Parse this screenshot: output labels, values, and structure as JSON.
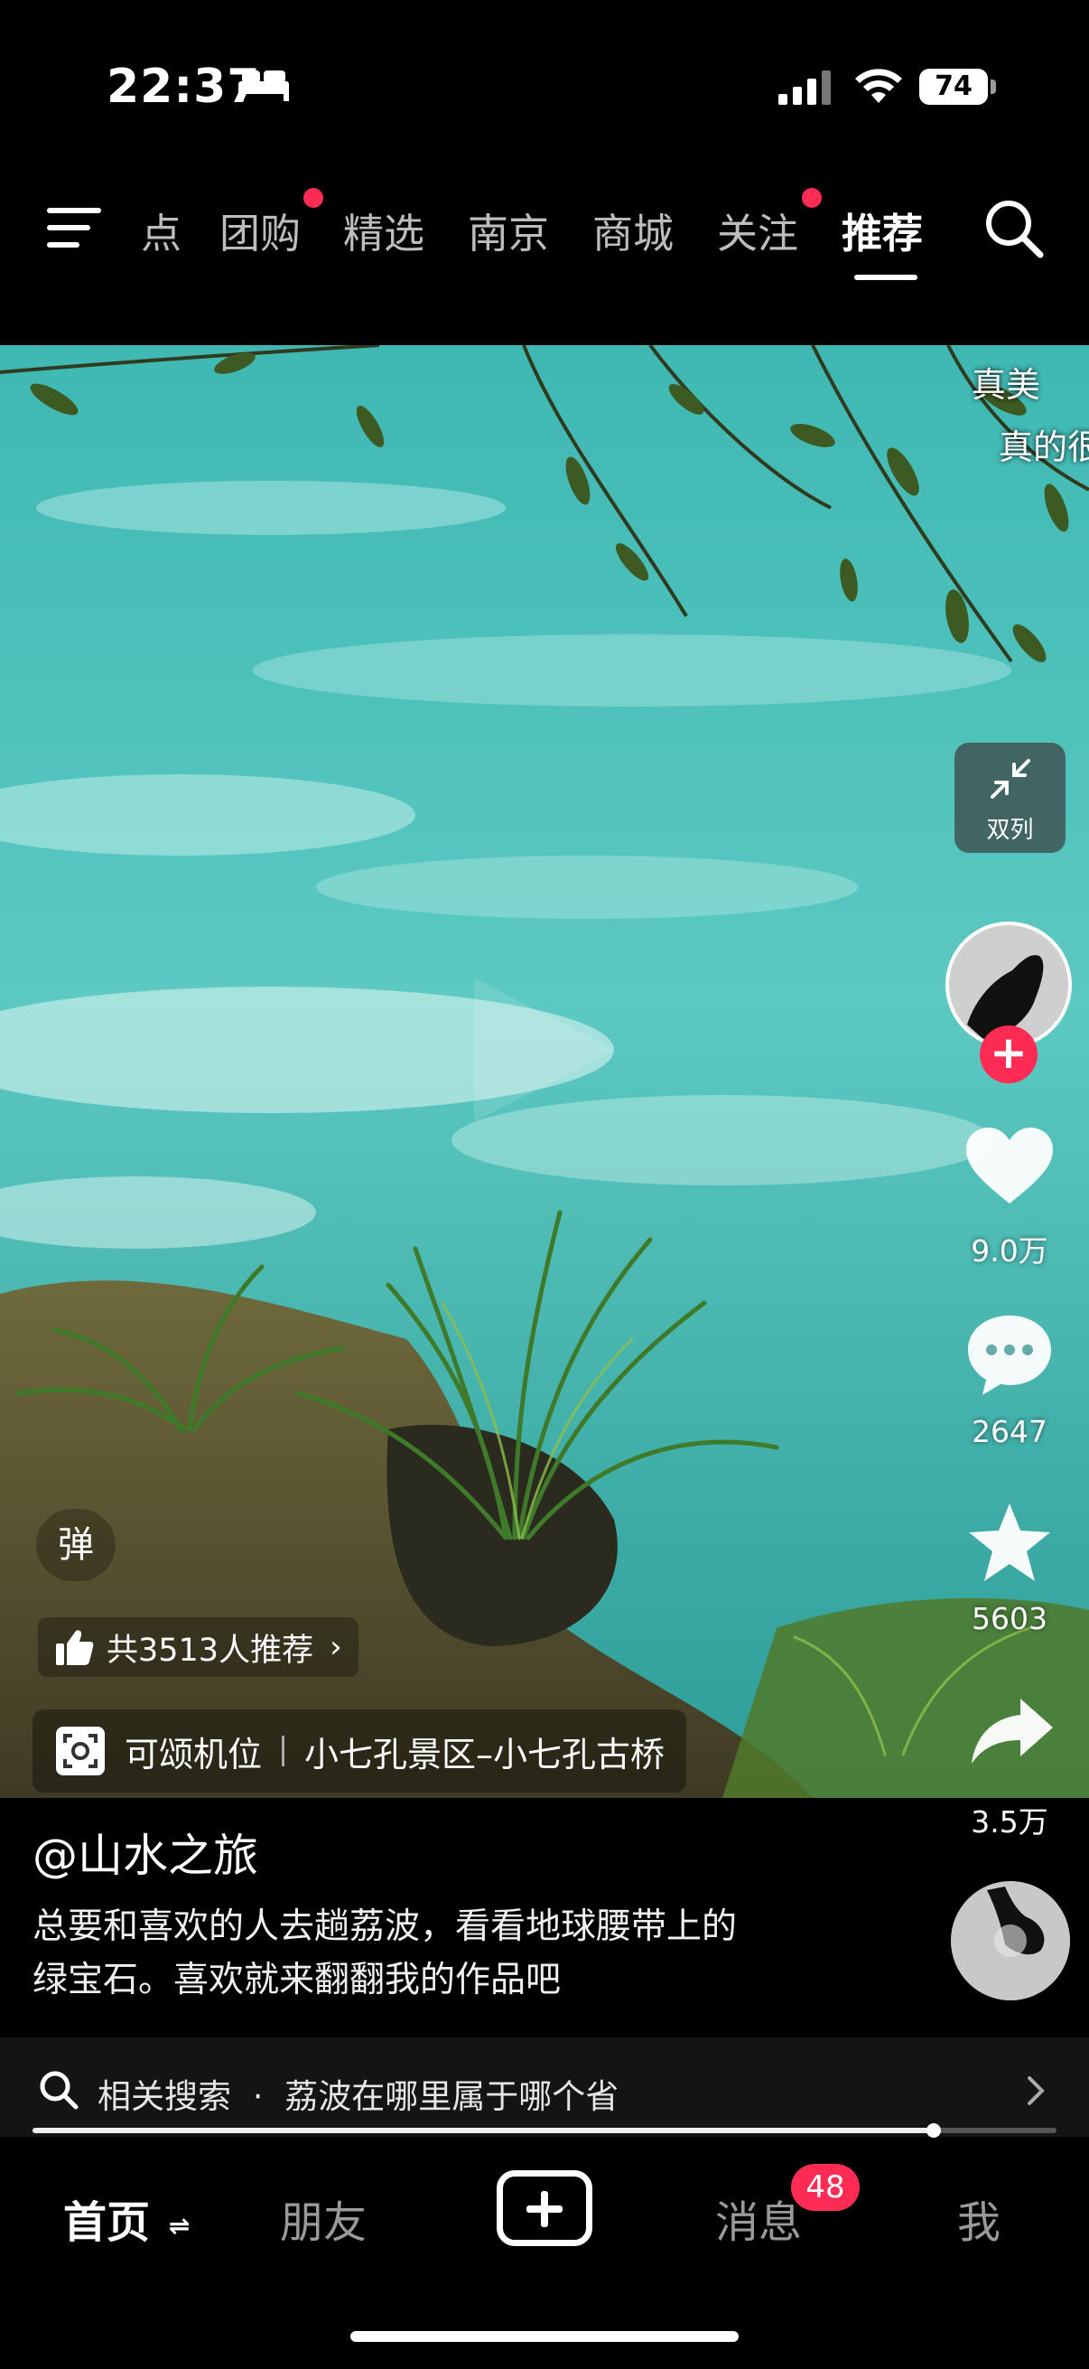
{
  "status_bar": {
    "time": "22:37",
    "battery": "74",
    "icons": [
      "bed-icon",
      "signal-icon",
      "wifi-icon",
      "battery-icon"
    ]
  },
  "top_nav": {
    "tabs": [
      {
        "label": "点",
        "dot": false,
        "active": false
      },
      {
        "label": "团购",
        "dot": true,
        "active": false
      },
      {
        "label": "精选",
        "dot": false,
        "active": false
      },
      {
        "label": "南京",
        "dot": false,
        "active": false
      },
      {
        "label": "商城",
        "dot": false,
        "active": false
      },
      {
        "label": "关注",
        "dot": true,
        "active": false
      },
      {
        "label": "推荐",
        "dot": false,
        "active": true
      }
    ]
  },
  "video": {
    "caption_overlay_line1": "真美",
    "caption_overlay_line2": "真的很",
    "dual_column_label": "双列",
    "danmu_label": "弹",
    "recommend_text": "共3513人推荐",
    "location_tag": "可颂机位",
    "location_name": "小七孔景区–小七孔古桥"
  },
  "sidebar": {
    "likes": "9.0万",
    "comments": "2647",
    "favorites": "5603",
    "shares": "3.5万"
  },
  "post": {
    "author": "@山水之旅",
    "description_line1": "总要和喜欢的人去趟荔波，看看地球腰带上的",
    "description_line2": "绿宝石。喜欢就来翻翻我的作品吧"
  },
  "related_search": {
    "label": "相关搜索",
    "separator": "·",
    "query": "荔波在哪里属于哪个省"
  },
  "playback": {
    "progress": 0.88
  },
  "bottom_tabs": {
    "home": "首页",
    "friends": "朋友",
    "messages": "消息",
    "messages_badge": "48",
    "me": "我"
  },
  "colors": {
    "accent": "#fe2c55",
    "water": "#4fc7c0"
  }
}
